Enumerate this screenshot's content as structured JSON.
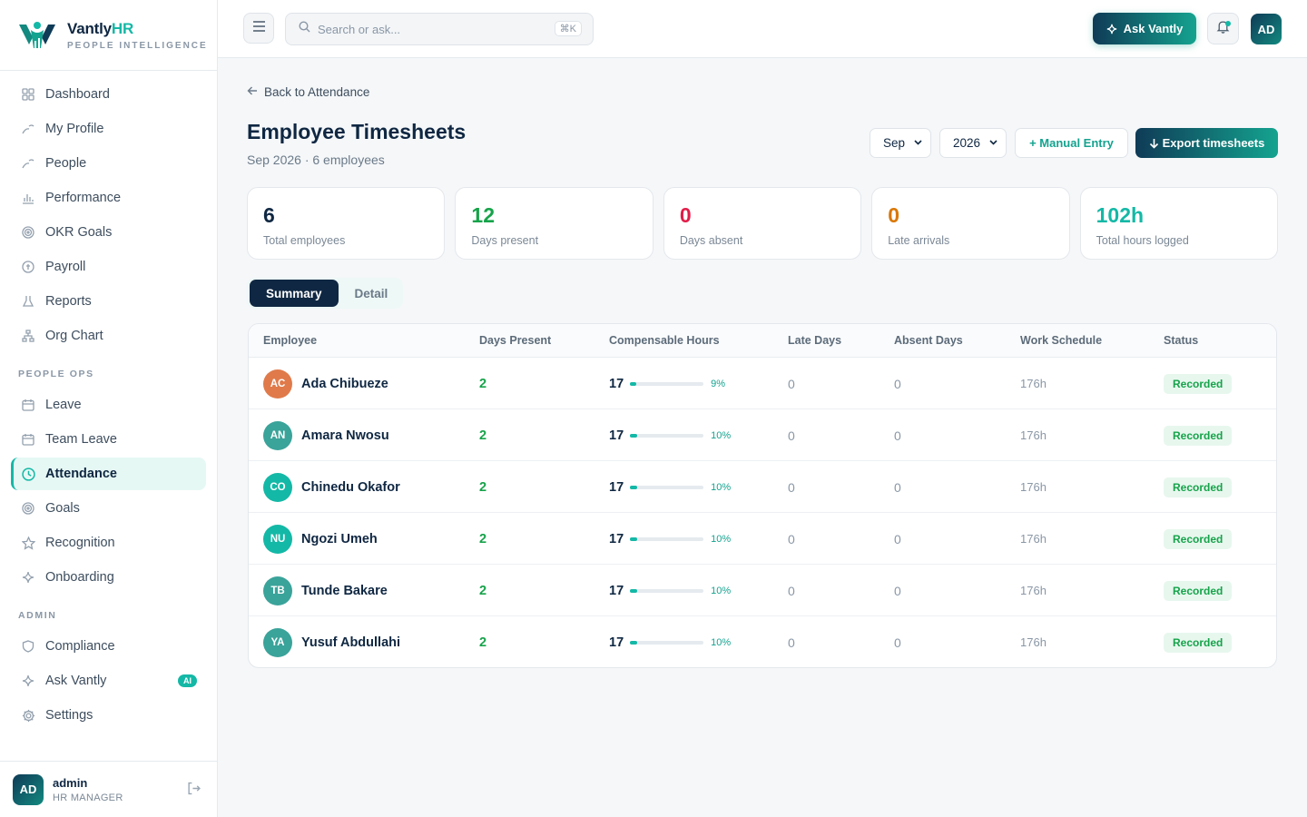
{
  "brand": {
    "name": "Vantly",
    "name_suffix": "HR",
    "tagline": "PEOPLE INTELLIGENCE"
  },
  "sidebar": {
    "items": [
      {
        "label": "Dashboard",
        "icon": "grid-icon"
      },
      {
        "label": "My Profile",
        "icon": "person-icon"
      },
      {
        "label": "People",
        "icon": "people-icon"
      },
      {
        "label": "Performance",
        "icon": "bar-chart-icon"
      },
      {
        "label": "OKR Goals",
        "icon": "target-icon"
      },
      {
        "label": "Payroll",
        "icon": "coin-icon"
      },
      {
        "label": "Reports",
        "icon": "flask-icon"
      },
      {
        "label": "Org Chart",
        "icon": "org-chart-icon"
      }
    ],
    "section_people_ops": "PEOPLE OPS",
    "people_ops_items": [
      {
        "label": "Leave",
        "icon": "calendar-icon"
      },
      {
        "label": "Team Leave",
        "icon": "calendar-icon"
      },
      {
        "label": "Attendance",
        "icon": "clock-icon",
        "active": true
      },
      {
        "label": "Goals",
        "icon": "target-icon"
      },
      {
        "label": "Recognition",
        "icon": "star-icon"
      },
      {
        "label": "Onboarding",
        "icon": "sparkle-icon"
      }
    ],
    "section_admin": "ADMIN",
    "admin_items": [
      {
        "label": "Compliance",
        "icon": "shield-icon"
      },
      {
        "label": "Ask Vantly",
        "icon": "sparkle-icon",
        "badge": "AI"
      },
      {
        "label": "Settings",
        "icon": "gear-icon"
      }
    ],
    "user": {
      "initials": "AD",
      "name": "admin",
      "role": "HR MANAGER"
    }
  },
  "topbar": {
    "search_placeholder": "Search or ask...",
    "search_shortcut": "⌘K",
    "ask_label": "Ask Vantly",
    "avatar_initials": "AD"
  },
  "page": {
    "back_label": "Back to Attendance",
    "title": "Employee Timesheets",
    "subtitle": "Sep 2026 · 6 employees",
    "month_value": "Sep",
    "year_value": "2026",
    "manual_entry_label": "+ Manual Entry",
    "export_label": "Export timesheets"
  },
  "stats": [
    {
      "value": "6",
      "label": "Total employees",
      "color": "#0f2742"
    },
    {
      "value": "12",
      "label": "Days present",
      "color": "#16a34a"
    },
    {
      "value": "0",
      "label": "Days absent",
      "color": "#e11d48"
    },
    {
      "value": "0",
      "label": "Late arrivals",
      "color": "#d97706"
    },
    {
      "value": "102h",
      "label": "Total hours logged",
      "color": "#14b8a6"
    }
  ],
  "tabs": {
    "summary": "Summary",
    "detail": "Detail"
  },
  "table": {
    "headers": [
      "Employee",
      "Days Present",
      "Compensable Hours",
      "Late Days",
      "Absent Days",
      "Work Schedule",
      "Status"
    ],
    "rows": [
      {
        "initials": "AC",
        "avatar_color": "#e07a4a",
        "name": "Ada Chibueze",
        "present": "2",
        "hours": "17",
        "pct_value": 9,
        "pct": "9%",
        "late": "0",
        "absent": "0",
        "schedule": "176h",
        "status": "Recorded"
      },
      {
        "initials": "AN",
        "avatar_color": "#3aa39a",
        "name": "Amara Nwosu",
        "present": "2",
        "hours": "17",
        "pct_value": 10,
        "pct": "10%",
        "late": "0",
        "absent": "0",
        "schedule": "176h",
        "status": "Recorded"
      },
      {
        "initials": "CO",
        "avatar_color": "#14b8a6",
        "name": "Chinedu Okafor",
        "present": "2",
        "hours": "17",
        "pct_value": 10,
        "pct": "10%",
        "late": "0",
        "absent": "0",
        "schedule": "176h",
        "status": "Recorded"
      },
      {
        "initials": "NU",
        "avatar_color": "#14b8a6",
        "name": "Ngozi Umeh",
        "present": "2",
        "hours": "17",
        "pct_value": 10,
        "pct": "10%",
        "late": "0",
        "absent": "0",
        "schedule": "176h",
        "status": "Recorded"
      },
      {
        "initials": "TB",
        "avatar_color": "#3aa39a",
        "name": "Tunde Bakare",
        "present": "2",
        "hours": "17",
        "pct_value": 10,
        "pct": "10%",
        "late": "0",
        "absent": "0",
        "schedule": "176h",
        "status": "Recorded"
      },
      {
        "initials": "YA",
        "avatar_color": "#3aa39a",
        "name": "Yusuf Abdullahi",
        "present": "2",
        "hours": "17",
        "pct_value": 10,
        "pct": "10%",
        "late": "0",
        "absent": "0",
        "schedule": "176h",
        "status": "Recorded"
      }
    ]
  }
}
